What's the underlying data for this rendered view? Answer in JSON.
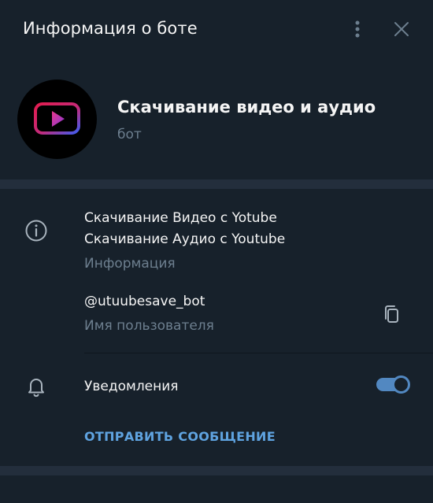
{
  "header": {
    "title": "Информация о боте"
  },
  "profile": {
    "name": "Скачивание видео и аудио",
    "type_label": "бот"
  },
  "info": {
    "description_line1": "Скачивание Видео с Yotube",
    "description_line2": "Скачивание Аудио с Youtube",
    "description_label": "Информация",
    "username": "@utuubesave_bot",
    "username_label": "Имя пользователя"
  },
  "notifications": {
    "label": "Уведомления",
    "enabled": true
  },
  "actions": {
    "send_message": "ОТПРАВИТЬ СООБЩЕНИЕ"
  },
  "colors": {
    "background": "#17212b",
    "section_gap": "#232e3c",
    "accent": "#5288c1",
    "link": "#5fa3e0",
    "secondary_text": "#6d7f8f"
  },
  "icons": {
    "menu": "more-vertical-icon",
    "close": "close-icon",
    "avatar": "youtube-play-logo-icon",
    "info": "info-circle-icon",
    "copy": "copy-icon",
    "notifications": "bell-icon"
  }
}
